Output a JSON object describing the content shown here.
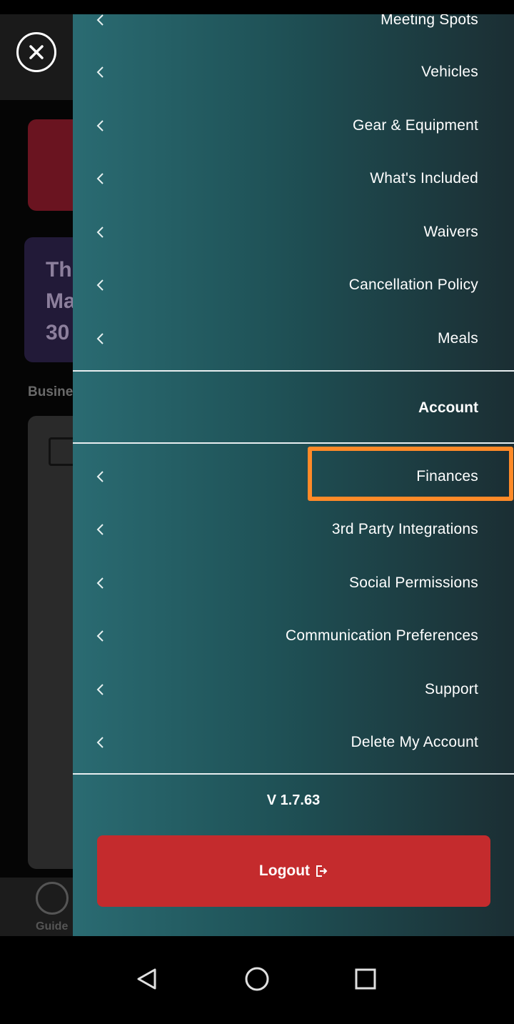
{
  "background": {
    "card_text": "Th\nMa\n30",
    "section_label": "Busine",
    "nav_label": "Guide"
  },
  "drawer": {
    "items_top": [
      {
        "label": "Meeting Spots"
      },
      {
        "label": "Vehicles"
      },
      {
        "label": "Gear & Equipment"
      },
      {
        "label": "What's Included"
      },
      {
        "label": "Waivers"
      },
      {
        "label": "Cancellation Policy"
      },
      {
        "label": "Meals"
      }
    ],
    "account_section_title": "Account",
    "items_account": [
      {
        "label": "Finances"
      },
      {
        "label": "3rd Party Integrations"
      },
      {
        "label": "Social Permissions"
      },
      {
        "label": "Communication Preferences"
      },
      {
        "label": "Support"
      },
      {
        "label": "Delete My Account"
      }
    ],
    "version": "V 1.7.63",
    "logout_label": "Logout"
  },
  "icons": {
    "close": "close-icon",
    "chevron": "chevron-left-icon",
    "logout": "logout-icon",
    "back": "back-triangle-icon",
    "home": "home-circle-icon",
    "recents": "recents-square-icon"
  },
  "colors": {
    "highlight": "#ff8a28",
    "logout_bg": "#c42b2d",
    "drawer_teal": "#2a6b72"
  }
}
